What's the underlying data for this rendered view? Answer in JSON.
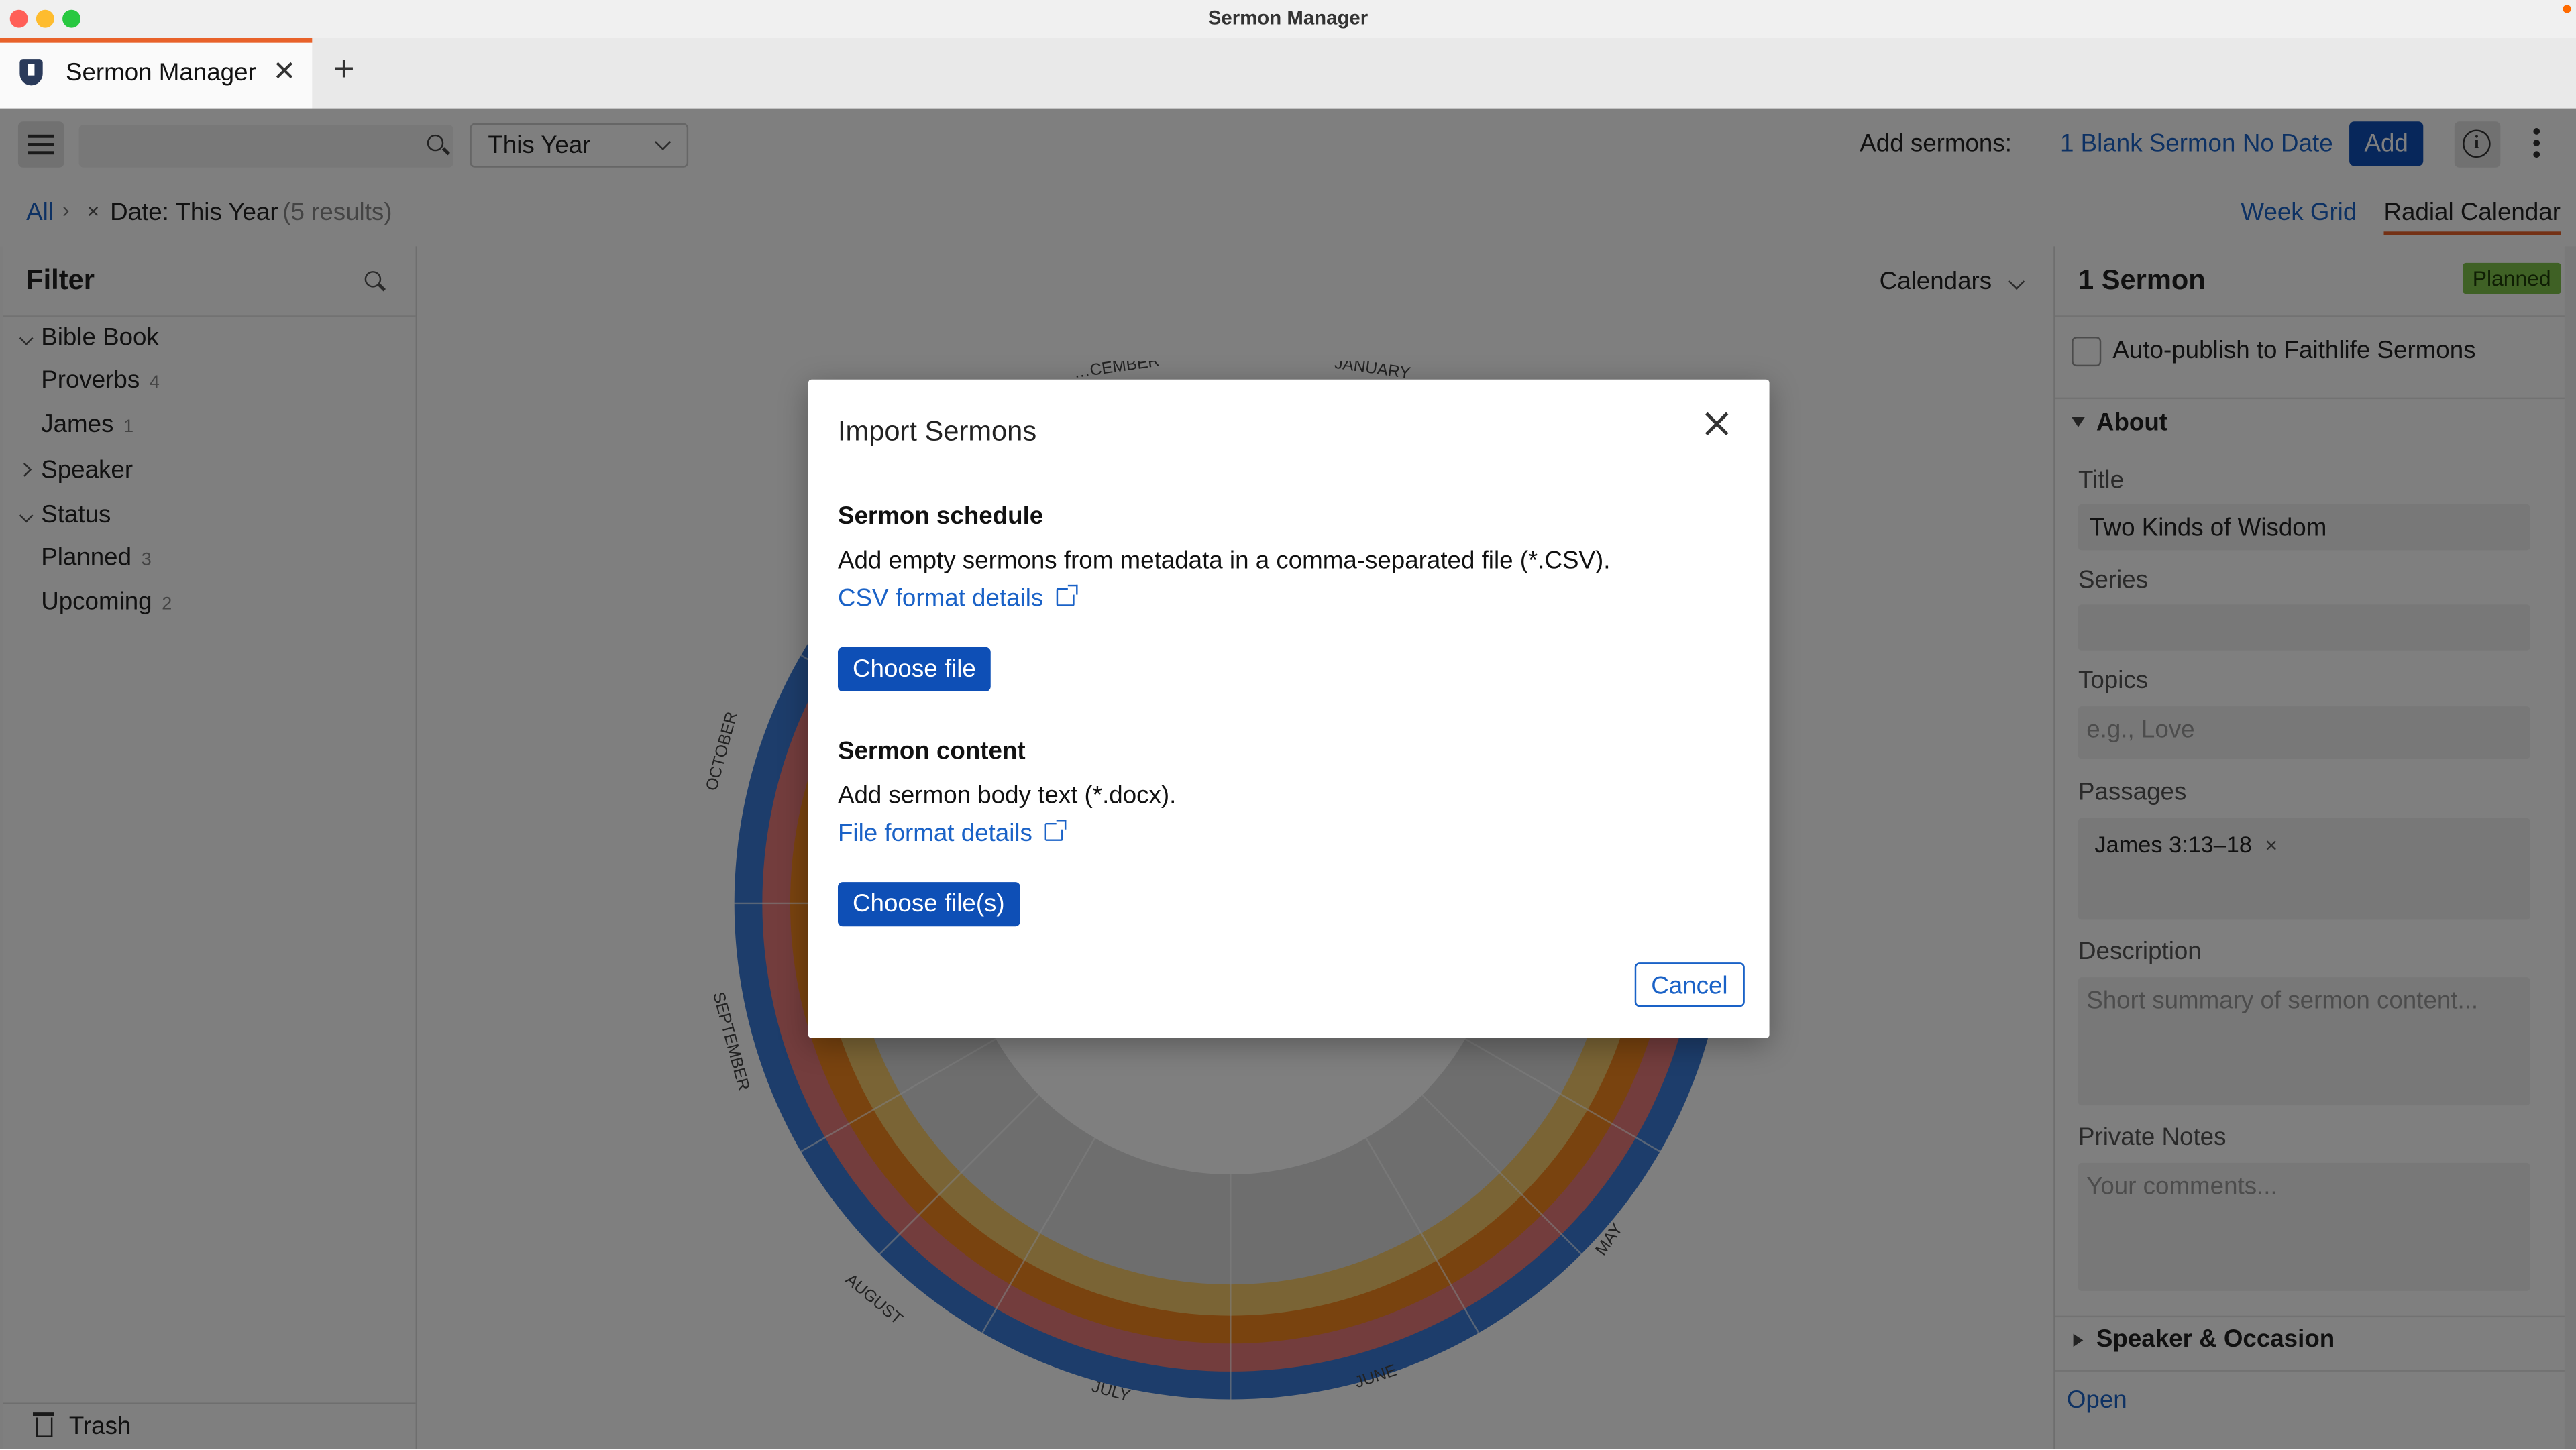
{
  "window": {
    "title": "Sermon Manager"
  },
  "tab": {
    "label": "Sermon Manager",
    "close": "✕",
    "add": "+"
  },
  "toolbar": {
    "search_placeholder": "",
    "date_filter": "This Year",
    "add_sermons_label": "Add sermons:",
    "blank_sermon_link": "1 Blank Sermon",
    "no_date_link": "No Date",
    "add_button": "Add",
    "info_icon": "i"
  },
  "breadcrumb": {
    "all": "All",
    "separator": "›",
    "remove": "×",
    "date_filter": "Date: This Year",
    "result_count": "(5 results)"
  },
  "views": {
    "week_grid": "Week Grid",
    "radial_calendar": "Radial Calendar",
    "active": "Radial Calendar"
  },
  "filter": {
    "title": "Filter",
    "groups": [
      {
        "label": "Bible Book",
        "expanded": true,
        "items": [
          {
            "label": "Proverbs",
            "count": "4"
          },
          {
            "label": "James",
            "count": "1"
          }
        ]
      },
      {
        "label": "Speaker",
        "expanded": false,
        "items": []
      },
      {
        "label": "Status",
        "expanded": true,
        "items": [
          {
            "label": "Planned",
            "count": "3"
          },
          {
            "label": "Upcoming",
            "count": "2"
          }
        ]
      }
    ],
    "trash": "Trash"
  },
  "center": {
    "calendars_select": "Calendars",
    "months": [
      "JANUARY",
      "MAY",
      "JUNE",
      "JULY",
      "AUGUST",
      "SEPTEMBER",
      "OCTOBER",
      "…CEMBER"
    ]
  },
  "details": {
    "title": "1 Sermon",
    "status": "Planned",
    "auto_publish": "Auto-publish to Faithlife Sermons",
    "about_section": "About",
    "fields": {
      "title_label": "Title",
      "title_value": "Two Kinds of Wisdom",
      "series_label": "Series",
      "series_value": "",
      "topics_label": "Topics",
      "topics_placeholder": "e.g., Love",
      "passages_label": "Passages",
      "passage": "James 3:13–18",
      "passage_remove": "×",
      "description_label": "Description",
      "description_placeholder": "Short summary of sermon content...",
      "notes_label": "Private Notes",
      "notes_placeholder": "Your comments..."
    },
    "speaker_section": "Speaker & Occasion",
    "open_link": "Open"
  },
  "modal": {
    "title": "Import Sermons",
    "schedule_heading": "Sermon schedule",
    "schedule_text": "Add empty sermons from metadata in a comma-separated file (*.CSV).",
    "csv_link": "CSV format details",
    "choose_file": "Choose file",
    "content_heading": "Sermon content",
    "content_text": "Add sermon body text (*.docx).",
    "file_link": "File format details",
    "choose_files": "Choose file(s)",
    "cancel": "Cancel"
  },
  "colors": {
    "accent": "#e8622a",
    "primary_button": "#0e4fb6",
    "link": "#1a62c7",
    "planned_badge": "#7fc24a"
  }
}
